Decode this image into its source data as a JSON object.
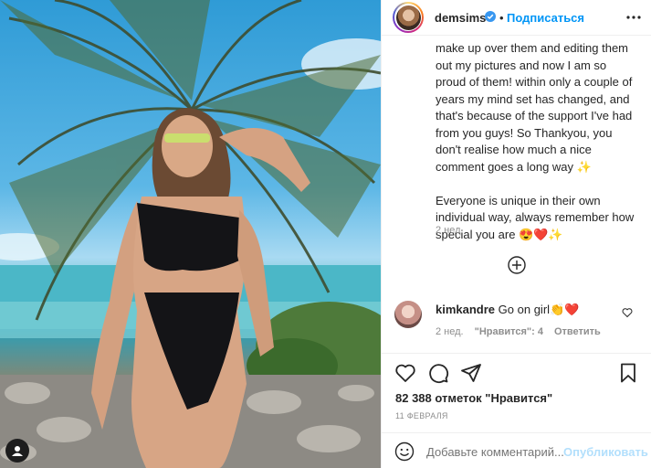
{
  "header": {
    "username": "demsims",
    "follow_label": "Подписаться",
    "dot": "•"
  },
  "caption": {
    "lines_a": [
      "make up over them and editing them",
      "out my pictures and now I am so",
      "proud of them! within only a couple of",
      "years my mind set has changed, and",
      "that's because of the support I've had",
      "from you guys! So Thankyou, you",
      "don't realise how much a nice",
      "comment goes a long way ✨"
    ],
    "lines_b": [
      "Everyone is unique in their own",
      "individual way, always remember how",
      "special you are 😍❤️✨"
    ],
    "time": "2 нед."
  },
  "comment": {
    "username": "kimkandre",
    "text": "Go on girl👏❤️",
    "time": "2 нед.",
    "likes": "\"Нравится\": 4",
    "reply": "Ответить"
  },
  "likes_text": "82 388 отметок \"Нравится\"",
  "date": "11 ФЕВРАЛЯ",
  "add_comment": {
    "placeholder": "Добавьте комментарий...",
    "publish_label": "Опубликовать"
  },
  "icons": {
    "verified": "verified-badge-icon",
    "more": "more-options-icon",
    "heart": "heart-icon",
    "comment": "comment-icon",
    "share": "share-icon",
    "save": "bookmark-icon",
    "emoji": "emoji-icon",
    "load_more": "plus-circle-icon",
    "user_tag": "user-tag-icon"
  },
  "colors": {
    "accent": "#0095f6",
    "publish_disabled": "#b2dffc",
    "muted": "#8e8e8e",
    "text": "#262626"
  }
}
